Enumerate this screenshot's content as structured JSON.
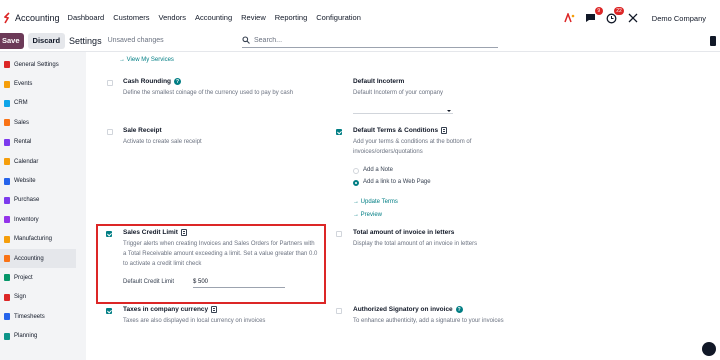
{
  "header": {
    "app_name": "Accounting",
    "menu": [
      "Dashboard",
      "Customers",
      "Vendors",
      "Accounting",
      "Review",
      "Reporting",
      "Configuration"
    ],
    "activity_badge": "9",
    "messages_badge": "22",
    "company": "Demo Company"
  },
  "control": {
    "save": "Save",
    "discard": "Discard",
    "title": "Settings",
    "status": "Unsaved changes",
    "search_placeholder": "Search..."
  },
  "sidebar": [
    {
      "label": "General Settings",
      "color": "#dc2626"
    },
    {
      "label": "Events",
      "color": "#f59e0b"
    },
    {
      "label": "CRM",
      "color": "#0ea5e9"
    },
    {
      "label": "Sales",
      "color": "#f97316"
    },
    {
      "label": "Rental",
      "color": "#7c3aed"
    },
    {
      "label": "Calendar",
      "color": "#f59e0b"
    },
    {
      "label": "Website",
      "color": "#2563eb"
    },
    {
      "label": "Purchase",
      "color": "#7c3aed"
    },
    {
      "label": "Inventory",
      "color": "#9333ea"
    },
    {
      "label": "Manufacturing",
      "color": "#f59e0b"
    },
    {
      "label": "Accounting",
      "color": "#f97316",
      "active": true
    },
    {
      "label": "Project",
      "color": "#059669"
    },
    {
      "label": "Sign",
      "color": "#dc2626"
    },
    {
      "label": "Timesheets",
      "color": "#2563eb"
    },
    {
      "label": "Planning",
      "color": "#0d9488"
    }
  ],
  "settings": {
    "view_services": "→ View My Services",
    "cash_rounding": {
      "title": "Cash Rounding",
      "desc": "Define the smallest coinage of the currency used to pay by cash"
    },
    "default_incoterm": {
      "title": "Default Incoterm",
      "desc": "Default Incoterm of your company"
    },
    "sale_receipt": {
      "title": "Sale Receipt",
      "desc": "Activate to create sale receipt"
    },
    "default_terms": {
      "title": "Default Terms & Conditions",
      "desc": "Add your terms & conditions at the bottom of invoices/orders/quotations",
      "option_note": "Add a Note",
      "option_link": "Add a link to a Web Page",
      "update_terms": "→ Update Terms",
      "preview": "→ Preview"
    },
    "credit_limit": {
      "title": "Sales Credit Limit",
      "desc": "Trigger alerts when creating Invoices and Sales Orders for Partners with a Total Receivable amount exceeding a limit. Set a value greater than 0.0 to activate a credit limit check",
      "field_label": "Default Credit Limit",
      "field_value": "$ 500"
    },
    "amount_letters": {
      "title": "Total amount of invoice in letters",
      "desc": "Display the total amount of an invoice in letters"
    },
    "taxes_currency": {
      "title": "Taxes in company currency",
      "desc": "Taxes are also displayed in local currency on invoices"
    },
    "signatory": {
      "title": "Authorized Signatory on invoice",
      "desc": "To enhance authenticity, add a signature to your invoices"
    }
  }
}
